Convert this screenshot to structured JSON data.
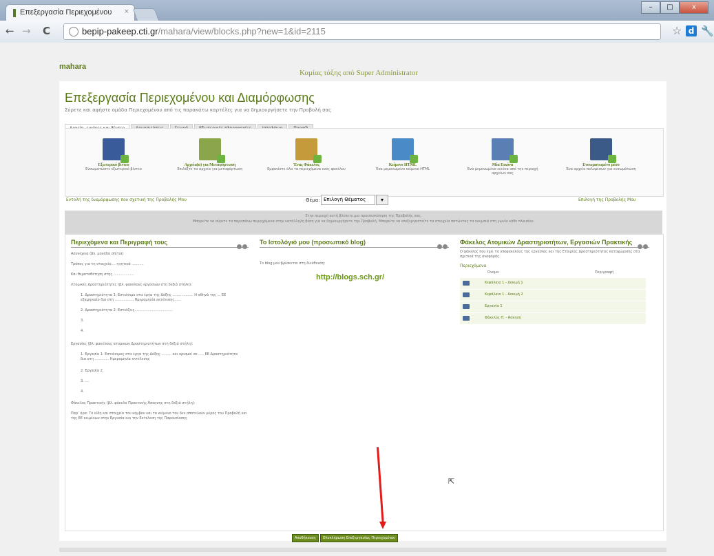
{
  "browser": {
    "tab_title": "Επεξεργασία Περιεχομένου",
    "tab_close": "×",
    "url_host": "bepip-pakeep.cti.gr",
    "url_path": "/mahara/view/blocks.php?new=1&id=2115",
    "back": "←",
    "forward": "→",
    "reload": "C",
    "star": "☆",
    "ext": "d",
    "wrench": "🔧",
    "min": "–",
    "max": "□",
    "close": "x"
  },
  "site": {
    "logo": "mahara",
    "welcome": "Καμίας τάξης από Super Administrator"
  },
  "page": {
    "title": "Επεξεργασία Περιεχομένου και Διαμόρφωσης",
    "subtitle": "Σύρετε και αφήστε ομάδα Περιεχομένου από τις παρακάτω καρτέλες για να δημιουργήσετε την Προβολή σας"
  },
  "tabs": [
    "Αρχεία, εικόνες και βίντεο",
    "Δημοσιεύσεις",
    "Γενικά",
    "Εξωτερικές πληροφορίες",
    "Ιστολόγιο",
    "Προφίλ"
  ],
  "blocks": [
    {
      "name": "Εξωτερικό βίντεο",
      "desc": "Ενσωματώστε εξωτερικό βίντεο",
      "color": "#3a5b9a"
    },
    {
      "name": "Αρχεία(α) για Μεταφόρτωση",
      "desc": "Επιλέξτε τα αρχεία για μεταφόρτωση",
      "color": "#8aa54a"
    },
    {
      "name": "Ένας Φάκελος",
      "desc": "Εμφανίστε όλα τα περιεχόμενα ενός φακέλου",
      "color": "#c49a3a"
    },
    {
      "name": "Κείμενο HTML",
      "desc": "Ένα μεμονωμένο κείμενο HTML",
      "color": "#4a8ac6"
    },
    {
      "name": "Μία Εικόνα",
      "desc": "Ένα μεμονωμένο εικόνα από την περιοχή αρχείων σας",
      "color": "#5a7fb5"
    },
    {
      "name": "Ενσωματωμένο μέσο",
      "desc": "Ένα αρχείο πολυμέσων για ενσωμάτωση",
      "color": "#3b5a88"
    }
  ],
  "hints": {
    "left": "Εντολή της διαμόρφωσης που σχετική της Προβολής Μου",
    "right": "Επιλογή της Προβολής Μου"
  },
  "select": {
    "label": "Θέμα:",
    "value": "Επιλογή Θέματος",
    "arrow": "▾"
  },
  "notice": {
    "line1": "Στην περιοχή αυτή βλέπετε μια προεπισκόπηση της Προβολής σας.",
    "line2": "Μπορείτε να σύρετε τα παραπάνω περιεχόμενα στην κατάλληλη θέση για να δημιουργήσετε την Προβολή. Μπορείτε να επεξεργαστείτε τα στοιχεία πατώντας τα κουμπιά στη γωνία κάθε πλαισίου."
  },
  "col1": {
    "title": "Περιεχόμενα και Περιγραφή τους",
    "lines": [
      "Ασυνέχεια (βλ. μονάδα σπίτια)",
      "Τρόπος για τη στοιχείο.... ηγητικά ...........",
      "Και θεματοθέτηση στης ...................",
      "Λτομικές Δραστηριότητες (βλ. φακέλους εργασιών στη δεξιά στήλη):",
      "1.   Δραστηριότητα 1: Εστιάσιμο στα έργα της Δόξης ........ .......... Η αθηνά της ... ΕΕ εξαμηνιαίο δια στη ..................Ηµερομηνία εκτέλεσης......",
      "2.   Δραστηριότητα 2: Εστιάζεις...................................",
      "3.",
      "4.",
      "Εργασίες (βλ. φακέλους ατομικών Δραστηριοτήτων στη δεξιά στήλη):",
      "1.   Εργασία 1: Εστιάσιμος στα έργα της Δόξης ......... και ορισμοί σε ..... ΕΕ Δραστηριότητα δια στη ............. Ηµερομηνία εκτέλεσης",
      "2.   Εργασία 2",
      "3.   ....",
      "4.",
      "Φάκελος Πρακτικής (βλ. φάκελο Πρακτικής Άσκησης στη δεξιά στήλη):",
      "Παρ’ όρα: Το είδη και στοιχεία του κόμβου και τα κείμενο του δεν αποτελούν μέρος του Προβολή και της ΕΕ κειμένων στην Εργασία και την Εκτέλεση της Παρουσίασης"
    ]
  },
  "col2": {
    "title": "Το Ιστολόγιό μου (προσωπικό blog)",
    "intro": "Το blog μου βρίσκεται στη διεύθυνση:",
    "url": "http://blogs.sch.gr/"
  },
  "col3": {
    "title": "Φάκελος Ατομικών Δραστηριοτήτων, Εργασιών Πρακτικής",
    "desc": "Ο φάκελος που έχει τα υποφακέλους της εργασίας και της Εταιρίας Δραστηριότητας καταχώρισης στα σχετικά της αναφοράς.",
    "contents_label": "Περιεχόμενα",
    "col_name": "Όνομα",
    "col_desc": "Περιγραφή",
    "folders": [
      "Κεφάλαιο 1 - Δοκιμή 1",
      "Κεφάλαιο 1 - Δοκιμή 2",
      "Εργασία 1",
      "Φάκελος Π. - Άσκηση"
    ]
  },
  "footer_buttons": [
    "Αποθήκευση",
    "Ολοκλήρωση Επεξεργασίας Περιεχομένου"
  ]
}
